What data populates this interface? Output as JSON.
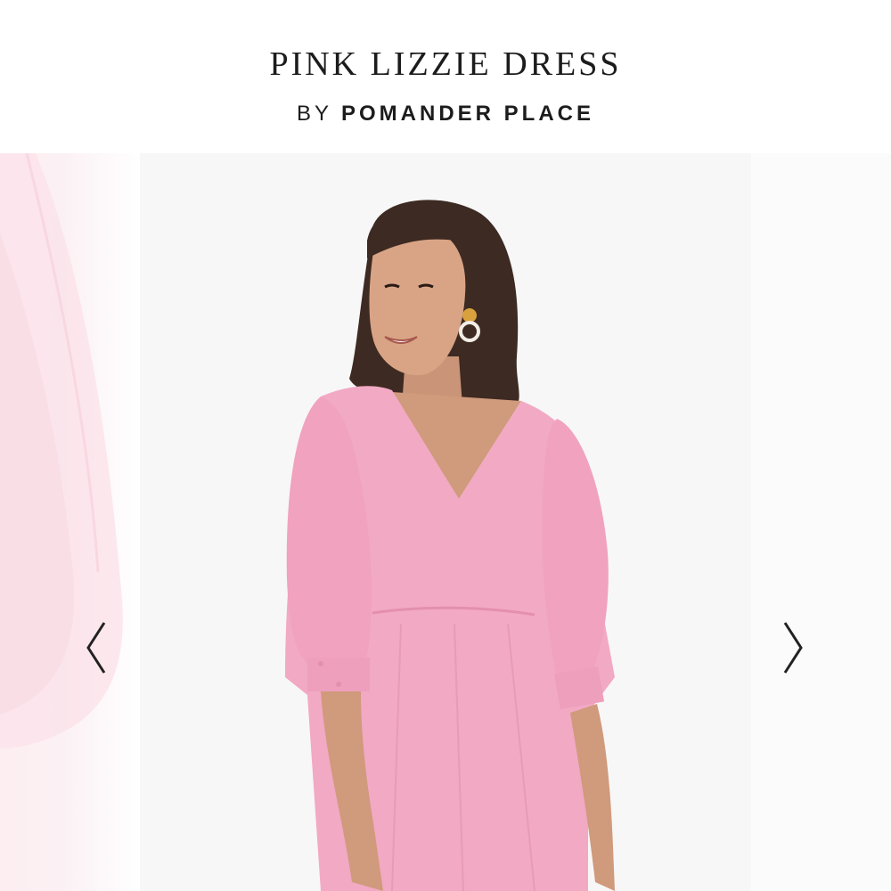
{
  "product": {
    "title": "PINK LIZZIE DRESS",
    "by_label": "BY",
    "brand": "POMANDER PLACE"
  },
  "carousel": {
    "image_alt": "Model wearing pink v-neck dress with puff sleeves",
    "prev_icon": "chevron-left-icon",
    "next_icon": "chevron-right-icon"
  },
  "colors": {
    "dress": "#f2a9c4",
    "text": "#1c1c1c"
  }
}
